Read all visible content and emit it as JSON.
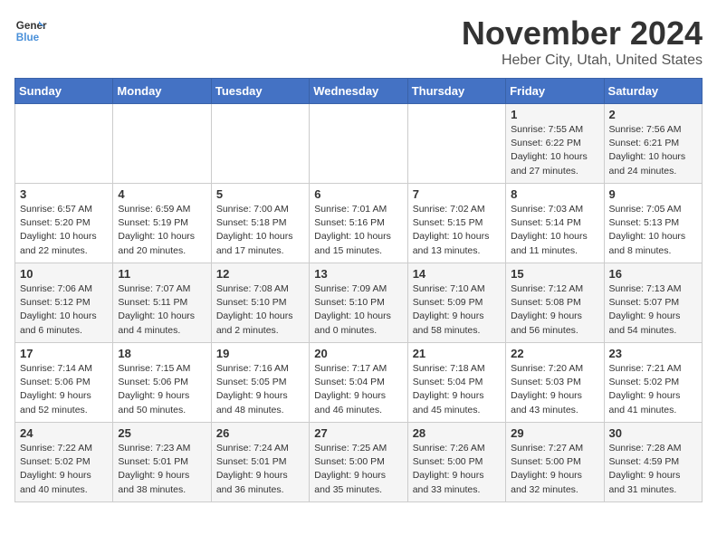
{
  "logo": {
    "line1": "General",
    "line2": "Blue"
  },
  "title": "November 2024",
  "location": "Heber City, Utah, United States",
  "weekdays": [
    "Sunday",
    "Monday",
    "Tuesday",
    "Wednesday",
    "Thursday",
    "Friday",
    "Saturday"
  ],
  "weeks": [
    [
      {
        "day": "",
        "info": ""
      },
      {
        "day": "",
        "info": ""
      },
      {
        "day": "",
        "info": ""
      },
      {
        "day": "",
        "info": ""
      },
      {
        "day": "",
        "info": ""
      },
      {
        "day": "1",
        "info": "Sunrise: 7:55 AM\nSunset: 6:22 PM\nDaylight: 10 hours\nand 27 minutes."
      },
      {
        "day": "2",
        "info": "Sunrise: 7:56 AM\nSunset: 6:21 PM\nDaylight: 10 hours\nand 24 minutes."
      }
    ],
    [
      {
        "day": "3",
        "info": "Sunrise: 6:57 AM\nSunset: 5:20 PM\nDaylight: 10 hours\nand 22 minutes."
      },
      {
        "day": "4",
        "info": "Sunrise: 6:59 AM\nSunset: 5:19 PM\nDaylight: 10 hours\nand 20 minutes."
      },
      {
        "day": "5",
        "info": "Sunrise: 7:00 AM\nSunset: 5:18 PM\nDaylight: 10 hours\nand 17 minutes."
      },
      {
        "day": "6",
        "info": "Sunrise: 7:01 AM\nSunset: 5:16 PM\nDaylight: 10 hours\nand 15 minutes."
      },
      {
        "day": "7",
        "info": "Sunrise: 7:02 AM\nSunset: 5:15 PM\nDaylight: 10 hours\nand 13 minutes."
      },
      {
        "day": "8",
        "info": "Sunrise: 7:03 AM\nSunset: 5:14 PM\nDaylight: 10 hours\nand 11 minutes."
      },
      {
        "day": "9",
        "info": "Sunrise: 7:05 AM\nSunset: 5:13 PM\nDaylight: 10 hours\nand 8 minutes."
      }
    ],
    [
      {
        "day": "10",
        "info": "Sunrise: 7:06 AM\nSunset: 5:12 PM\nDaylight: 10 hours\nand 6 minutes."
      },
      {
        "day": "11",
        "info": "Sunrise: 7:07 AM\nSunset: 5:11 PM\nDaylight: 10 hours\nand 4 minutes."
      },
      {
        "day": "12",
        "info": "Sunrise: 7:08 AM\nSunset: 5:10 PM\nDaylight: 10 hours\nand 2 minutes."
      },
      {
        "day": "13",
        "info": "Sunrise: 7:09 AM\nSunset: 5:10 PM\nDaylight: 10 hours\nand 0 minutes."
      },
      {
        "day": "14",
        "info": "Sunrise: 7:10 AM\nSunset: 5:09 PM\nDaylight: 9 hours\nand 58 minutes."
      },
      {
        "day": "15",
        "info": "Sunrise: 7:12 AM\nSunset: 5:08 PM\nDaylight: 9 hours\nand 56 minutes."
      },
      {
        "day": "16",
        "info": "Sunrise: 7:13 AM\nSunset: 5:07 PM\nDaylight: 9 hours\nand 54 minutes."
      }
    ],
    [
      {
        "day": "17",
        "info": "Sunrise: 7:14 AM\nSunset: 5:06 PM\nDaylight: 9 hours\nand 52 minutes."
      },
      {
        "day": "18",
        "info": "Sunrise: 7:15 AM\nSunset: 5:06 PM\nDaylight: 9 hours\nand 50 minutes."
      },
      {
        "day": "19",
        "info": "Sunrise: 7:16 AM\nSunset: 5:05 PM\nDaylight: 9 hours\nand 48 minutes."
      },
      {
        "day": "20",
        "info": "Sunrise: 7:17 AM\nSunset: 5:04 PM\nDaylight: 9 hours\nand 46 minutes."
      },
      {
        "day": "21",
        "info": "Sunrise: 7:18 AM\nSunset: 5:04 PM\nDaylight: 9 hours\nand 45 minutes."
      },
      {
        "day": "22",
        "info": "Sunrise: 7:20 AM\nSunset: 5:03 PM\nDaylight: 9 hours\nand 43 minutes."
      },
      {
        "day": "23",
        "info": "Sunrise: 7:21 AM\nSunset: 5:02 PM\nDaylight: 9 hours\nand 41 minutes."
      }
    ],
    [
      {
        "day": "24",
        "info": "Sunrise: 7:22 AM\nSunset: 5:02 PM\nDaylight: 9 hours\nand 40 minutes."
      },
      {
        "day": "25",
        "info": "Sunrise: 7:23 AM\nSunset: 5:01 PM\nDaylight: 9 hours\nand 38 minutes."
      },
      {
        "day": "26",
        "info": "Sunrise: 7:24 AM\nSunset: 5:01 PM\nDaylight: 9 hours\nand 36 minutes."
      },
      {
        "day": "27",
        "info": "Sunrise: 7:25 AM\nSunset: 5:00 PM\nDaylight: 9 hours\nand 35 minutes."
      },
      {
        "day": "28",
        "info": "Sunrise: 7:26 AM\nSunset: 5:00 PM\nDaylight: 9 hours\nand 33 minutes."
      },
      {
        "day": "29",
        "info": "Sunrise: 7:27 AM\nSunset: 5:00 PM\nDaylight: 9 hours\nand 32 minutes."
      },
      {
        "day": "30",
        "info": "Sunrise: 7:28 AM\nSunset: 4:59 PM\nDaylight: 9 hours\nand 31 minutes."
      }
    ]
  ]
}
